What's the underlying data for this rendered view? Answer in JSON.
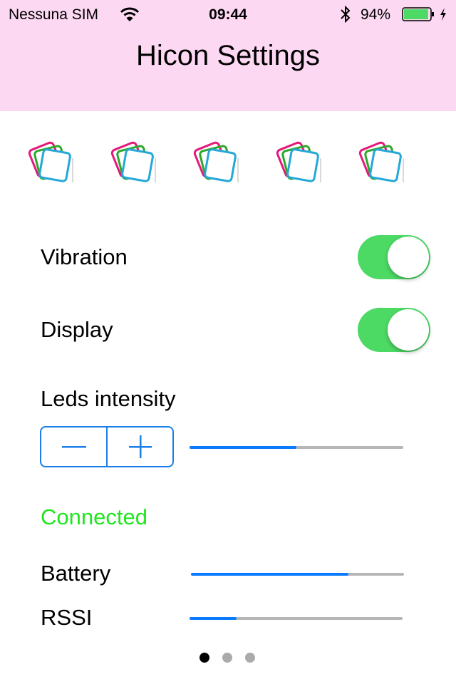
{
  "status_bar": {
    "carrier": "Nessuna SIM",
    "wifi_icon": "wifi-icon",
    "time": "09:44",
    "bluetooth_icon": "bluetooth-icon",
    "battery_percent": "94%",
    "battery_level": 0.94,
    "charging_icon": "bolt-icon"
  },
  "header": {
    "title": "Hicon Settings",
    "background": "#fdd8f2"
  },
  "icons": [
    {
      "name": "hicon-logo-icon"
    },
    {
      "name": "hicon-logo-icon"
    },
    {
      "name": "hicon-logo-icon"
    },
    {
      "name": "hicon-logo-icon"
    },
    {
      "name": "hicon-logo-icon"
    }
  ],
  "settings": {
    "vibration": {
      "label": "Vibration",
      "on": true
    },
    "display": {
      "label": "Display",
      "on": true
    },
    "leds": {
      "label": "Leds intensity",
      "decrement_icon": "minus-icon",
      "increment_icon": "plus-icon",
      "value": 0.5
    }
  },
  "connection": {
    "status": "Connected",
    "status_color": "#1fe61f",
    "battery": {
      "label": "Battery",
      "value": 0.74
    },
    "rssi": {
      "label": "RSSI",
      "value": 0.22
    }
  },
  "pager": {
    "pages": 3,
    "current": 1
  },
  "colors": {
    "accent": "#0a7aff",
    "switch_on": "#4cd964",
    "track": "#b6b6b6"
  }
}
